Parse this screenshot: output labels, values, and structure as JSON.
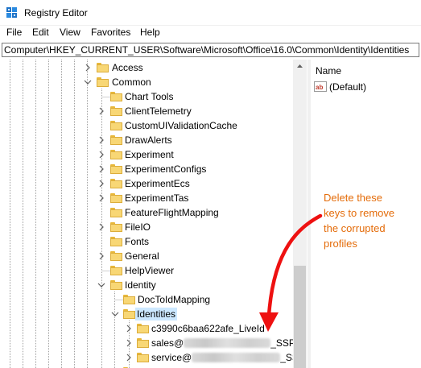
{
  "window": {
    "title": "Registry Editor",
    "icon": "registry-editor-icon"
  },
  "menu": [
    "File",
    "Edit",
    "View",
    "Favorites",
    "Help"
  ],
  "address": "Computer\\HKEY_CURRENT_USER\\Software\\Microsoft\\Office\\16.0\\Common\\Identity\\Identities",
  "tree": {
    "access": "Access",
    "common": "Common",
    "chart_tools": "Chart Tools",
    "client_telemetry": "ClientTelemetry",
    "custom_ui_validation_cache": "CustomUIValidationCache",
    "draw_alerts": "DrawAlerts",
    "experiment": "Experiment",
    "experiment_configs": "ExperimentConfigs",
    "experiment_ecs": "ExperimentEcs",
    "experiment_tas": "ExperimentTas",
    "feature_flight_mapping": "FeatureFlightMapping",
    "file_io": "FileIO",
    "fonts": "Fonts",
    "general": "General",
    "help_viewer": "HelpViewer",
    "identity": "Identity",
    "doc_told_mapping": "DocToIdMapping",
    "identities": "Identities",
    "profile_1": "c3990c6baa622afe_LiveId",
    "profile_2_prefix": "sales@",
    "profile_2_suffix": "_SSP",
    "profile_3_prefix": "service@",
    "profile_3_suffix": "_SS"
  },
  "values_pane": {
    "column_name": "Name",
    "default_value": "(Default)"
  },
  "annotation": {
    "lines": [
      "Delete these",
      "keys to remove",
      "the corrupted",
      "profiles"
    ],
    "color": "#e46c0a",
    "arrow_color": "#ee1111"
  }
}
